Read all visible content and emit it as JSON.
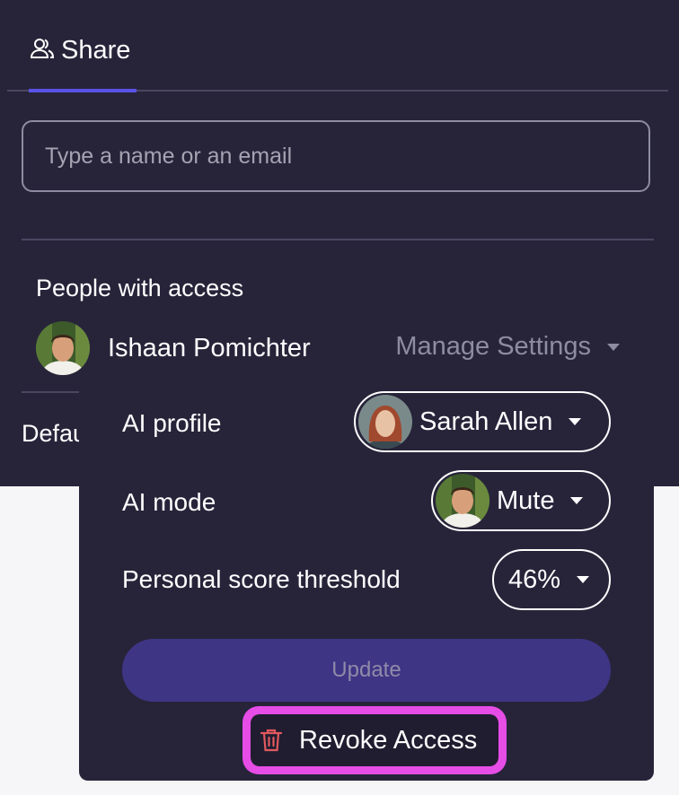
{
  "tabs": {
    "share_label": "Share"
  },
  "search": {
    "placeholder": "Type a name or an email"
  },
  "people": {
    "title": "People with access",
    "person_name": "Ishaan Pomichter",
    "manage_label": "Manage Settings"
  },
  "default_partial": "Default",
  "settings": {
    "ai_profile_label": "AI profile",
    "ai_profile_value": "Sarah Allen",
    "ai_mode_label": "AI mode",
    "ai_mode_value": "Mute",
    "threshold_label": "Personal score threshold",
    "threshold_value": "46%",
    "update_label": "Update",
    "revoke_label": "Revoke Access"
  },
  "colors": {
    "panel_bg": "#27243a",
    "accent": "#5b52e8",
    "update_bg": "#3e3585",
    "highlight": "#e64ce6",
    "danger": "#e0595e"
  },
  "icons": {
    "tab": "people-icon",
    "revoke": "trash-icon",
    "caret": "caret-down-icon"
  }
}
